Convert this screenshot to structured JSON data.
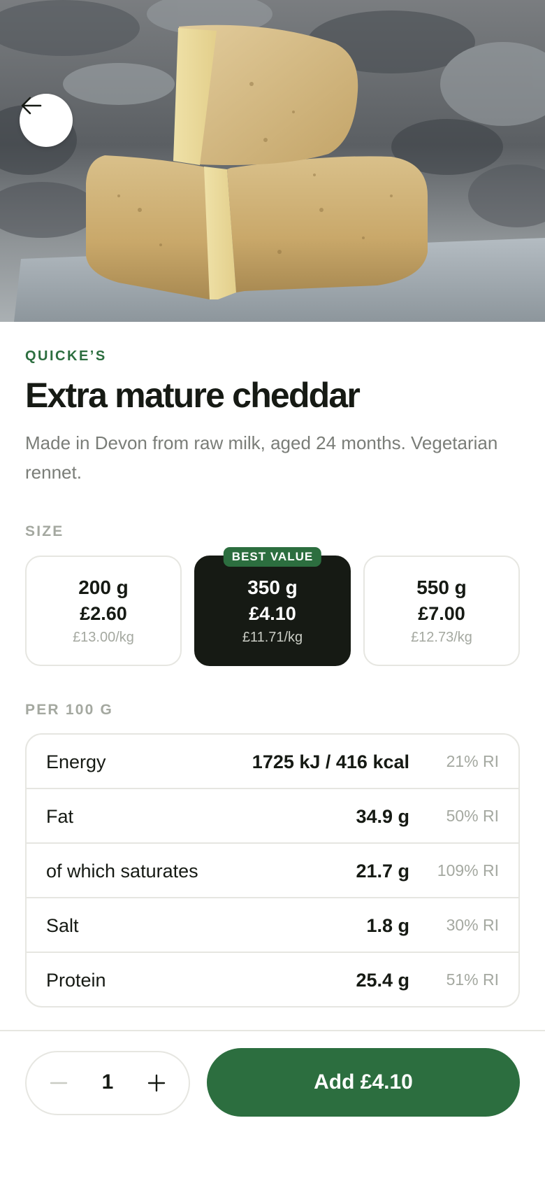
{
  "hero": {
    "image": "cheese-wheels-photo",
    "back_icon": "arrow-left-icon"
  },
  "product": {
    "brand": "QUICKE’S",
    "title": "Extra mature cheddar",
    "description": "Made in Devon from raw milk, aged 24 months. Vegetarian rennet."
  },
  "sizes": {
    "label": "SIZE",
    "selected_index": 1,
    "options": [
      {
        "weight": "200 g",
        "price": "£2.60",
        "unit_price": "£13.00/kg",
        "badge": ""
      },
      {
        "weight": "350 g",
        "price": "£4.10",
        "unit_price": "£11.71/kg",
        "badge": "BEST VALUE"
      },
      {
        "weight": "550 g",
        "price": "£7.00",
        "unit_price": "£12.73/kg",
        "badge": ""
      }
    ]
  },
  "nutrition": {
    "label": "PER 100 G",
    "rows": [
      {
        "name": "Energy",
        "amount": "1725 kJ / 416 kcal",
        "ri": "21% RI"
      },
      {
        "name": "Fat",
        "amount": "34.9 g",
        "ri": "50% RI"
      },
      {
        "name": "of which saturates",
        "amount": "21.7 g",
        "ri": "109% RI"
      },
      {
        "name": "Salt",
        "amount": "1.8 g",
        "ri": "30% RI"
      },
      {
        "name": "Protein",
        "amount": "25.4 g",
        "ri": "51% RI"
      }
    ]
  },
  "footer": {
    "quantity": "1",
    "minus_icon": "minus-icon",
    "plus_icon": "plus-icon",
    "add_label": "Add £4.10"
  },
  "colors": {
    "brand_green": "#2c6e3f",
    "selected_dark": "#161a14",
    "border": "#e6e6e1",
    "muted_text": "#a4a8a0"
  }
}
